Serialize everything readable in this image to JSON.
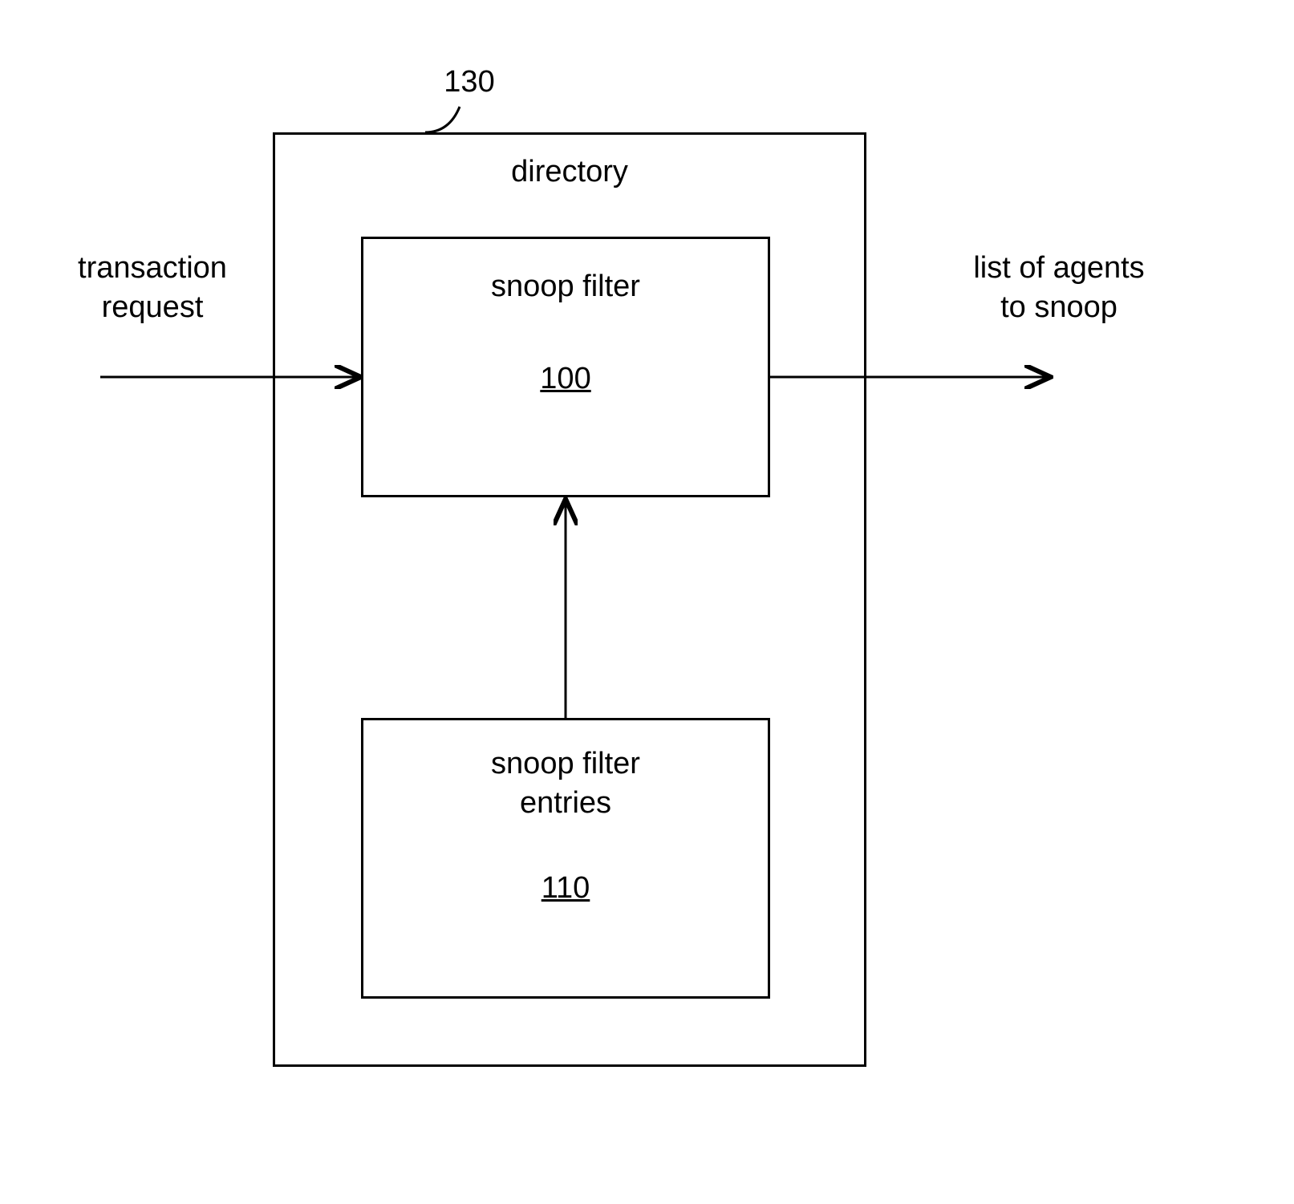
{
  "callout": {
    "ref": "130"
  },
  "directory": {
    "title": "directory"
  },
  "snoop_filter": {
    "title": "snoop filter",
    "ref": "100"
  },
  "snoop_entries": {
    "title": "snoop filter\nentries",
    "ref": "110"
  },
  "input_label": "transaction\nrequest",
  "output_label": "list of agents\nto snoop"
}
